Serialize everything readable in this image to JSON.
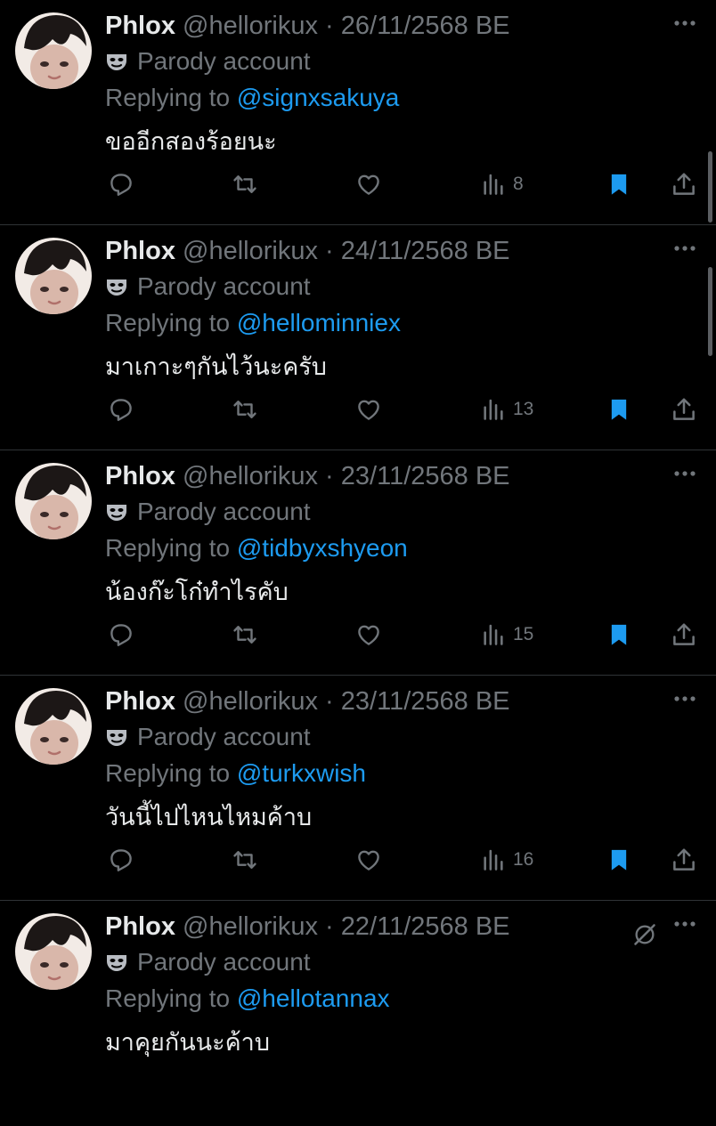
{
  "colors": {
    "background": "#000000",
    "text": "#e7e9ea",
    "muted": "#71767b",
    "link": "#1d9bf0",
    "bookmark": "#1d9bf0"
  },
  "icons": {
    "parody": "mask-icon",
    "reply": "reply-icon",
    "retweet": "retweet-icon",
    "like": "heart-icon",
    "views": "views-icon",
    "bookmark": "bookmark-icon",
    "share": "share-icon",
    "more": "more-icon",
    "grok": "grok-icon"
  },
  "tweets": [
    {
      "name": "Phlox",
      "handle": "@hellorikux",
      "separator": "·",
      "date": "26/11/2568 BE",
      "parody_label": "Parody account",
      "replying_prefix": "Replying to",
      "replying_to": "@signxsakuya",
      "text": "ขออีกสองร้อยนะ",
      "views": "8"
    },
    {
      "name": "Phlox",
      "handle": "@hellorikux",
      "separator": "·",
      "date": "24/11/2568 BE",
      "parody_label": "Parody account",
      "replying_prefix": "Replying to",
      "replying_to": "@hellominniex",
      "text": "มาเกาะๆกันไว้นะครับ",
      "views": "13"
    },
    {
      "name": "Phlox",
      "handle": "@hellorikux",
      "separator": "·",
      "date": "23/11/2568 BE",
      "parody_label": "Parody account",
      "replying_prefix": "Replying to",
      "replying_to": "@tidbyxshyeon",
      "text": "น้องก๊ะโก๋ทำไรคับ",
      "views": "15"
    },
    {
      "name": "Phlox",
      "handle": "@hellorikux",
      "separator": "·",
      "date": "23/11/2568 BE",
      "parody_label": "Parody account",
      "replying_prefix": "Replying to",
      "replying_to": "@turkxwish",
      "text": "วันนี้ไปไหนไหมค้าบ",
      "views": "16"
    },
    {
      "name": "Phlox",
      "handle": "@hellorikux",
      "separator": "·",
      "date": "22/11/2568 BE",
      "parody_label": "Parody account",
      "replying_prefix": "Replying to",
      "replying_to": "@hellotannax",
      "text": "มาคุยกันนะค้าบ",
      "views": ""
    }
  ]
}
